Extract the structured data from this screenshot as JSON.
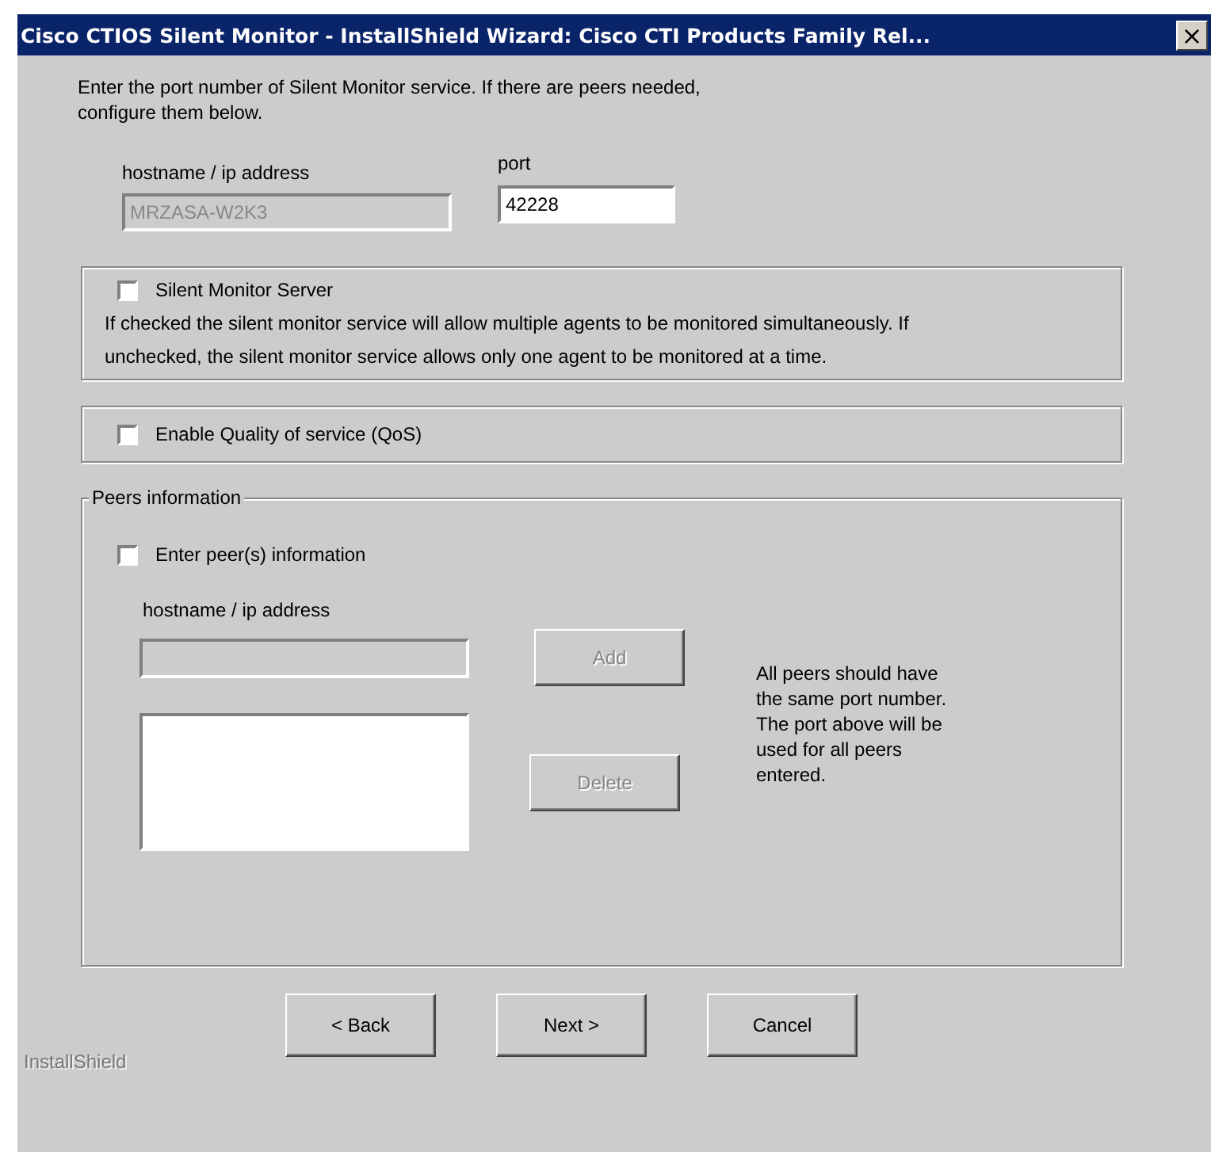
{
  "window": {
    "title": "Cisco CTIOS Silent Monitor - InstallShield Wizard: Cisco CTI Products Family Rel...",
    "close": "×"
  },
  "intro": "Enter the port number of Silent Monitor service. If there are peers needed, configure them below.",
  "server": {
    "host_label": "hostname / ip address",
    "host_value": "MRZASA-W2K3",
    "host_disabled": true,
    "port_label": "port",
    "port_value": "42228"
  },
  "silent_monitor_server": {
    "label": "Silent Monitor Server",
    "checked": false,
    "description": "If checked the silent monitor service will allow multiple agents to be monitored simultaneously.  If unchecked, the silent monitor service allows only one agent to be monitored at a time."
  },
  "qos": {
    "label": "Enable Quality of service (QoS)",
    "checked": false
  },
  "peers": {
    "legend": "Peers information",
    "checkbox": {
      "label": "Enter peer(s) information",
      "checked": false
    },
    "host_label": "hostname / ip address",
    "host_disabled": true,
    "add": {
      "label": "Add",
      "disabled": true
    },
    "delete": {
      "label": "Delete",
      "disabled": true
    },
    "note": "All peers should have the same port number. The port above will be used for all peers entered."
  },
  "brand": "InstallShield",
  "buttons": [
    {
      "label": "< Back",
      "disabled": false
    },
    {
      "label": "Next >",
      "disabled": false
    },
    {
      "label": "Cancel",
      "disabled": false
    }
  ]
}
